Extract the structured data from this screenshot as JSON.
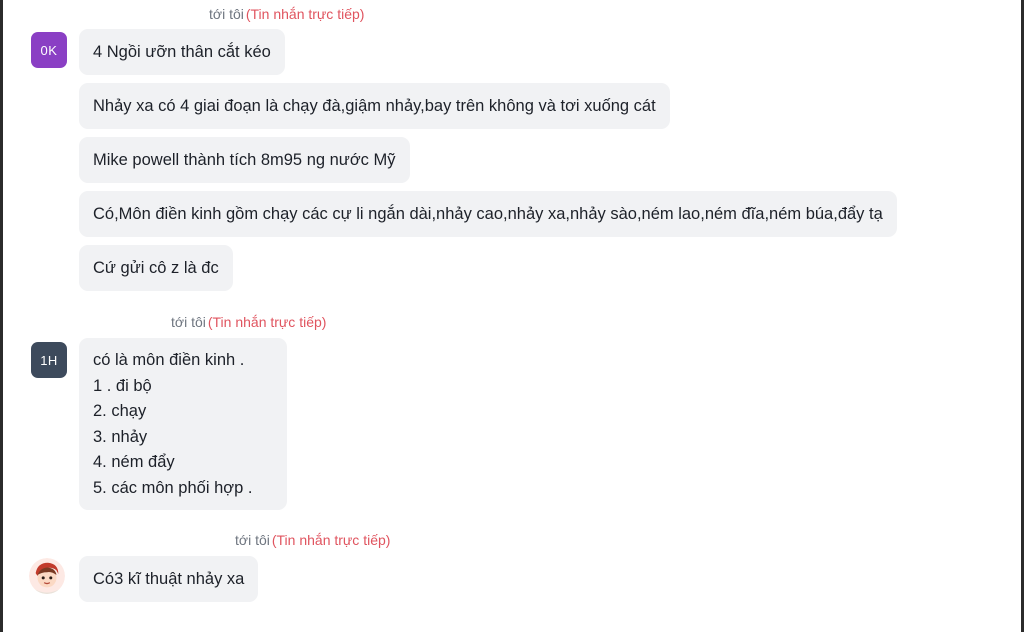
{
  "groups": [
    {
      "header": {
        "to": "tới tôi",
        "tag": "(Tin nhắn trực tiếp)"
      },
      "avatar": {
        "initials": "0K",
        "color": "#8a3fc4"
      },
      "messages": [
        "4 Ngồi ưỡn thân cắt kéo",
        "Nhảy xa có 4 giai đoạn là chạy đà,giậm nhảy,bay trên không và tơi xuống cát",
        "Mike powell thành tích 8m95 ng nước  Mỹ",
        "Có,Môn điền kinh gồm chạy các cự li ngắn dài,nhảy cao,nhảy xa,nhảy sào,ném lao,ném đĩa,ném búa,đẩy tạ",
        "Cứ gửi cô z là đc"
      ]
    },
    {
      "header": {
        "to": "tới tôi",
        "tag": "(Tin nhắn trực tiếp)"
      },
      "avatar": {
        "initials": "1H",
        "color": "#3d4a5c"
      },
      "messages": [
        {
          "lines": [
            "có là môn điền kinh .",
            "1 . đi bộ",
            "2. chạy",
            "3. nhảy",
            "4. ném đẩy",
            "5. các môn phối hợp ."
          ]
        }
      ]
    },
    {
      "header": {
        "to": "tới tôi",
        "tag": "(Tin nhắn trực tiếp)"
      },
      "avatar": {
        "icon": "cartoon-avatar-icon"
      },
      "messages": [
        "Có3 kĩ thuật nhảy xa"
      ]
    }
  ]
}
